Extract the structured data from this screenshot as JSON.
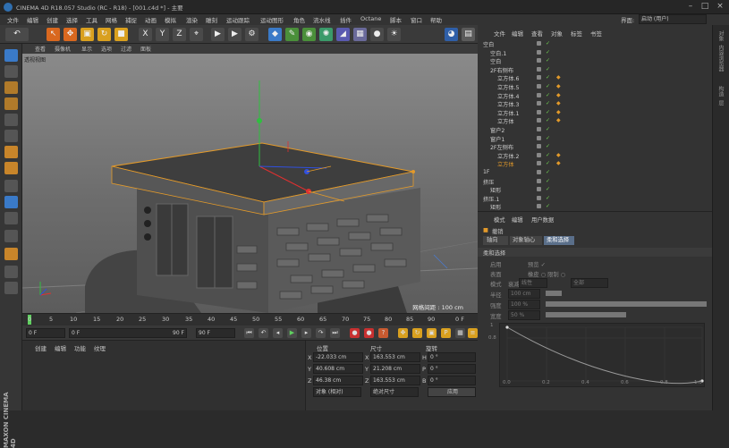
{
  "window": {
    "title": "CINEMA 4D R18.057 Studio (RC - R18) - [001.c4d *] - 主要"
  },
  "menu": {
    "items": [
      "文件",
      "编辑",
      "创建",
      "选择",
      "工具",
      "网格",
      "捕捉",
      "动画",
      "模拟",
      "渲染",
      "雕刻",
      "运动跟踪",
      "运动图形",
      "角色",
      "流水线",
      "插件",
      "Octane",
      "脚本",
      "窗口",
      "帮助"
    ],
    "interface_label": "界面:",
    "interface_value": "启动 (用户)"
  },
  "viewport": {
    "menu": [
      "查看",
      "摄像机",
      "显示",
      "选项",
      "过滤",
      "面板"
    ],
    "name": "透视视图",
    "grid_info": "网格间距 : 100 cm"
  },
  "timeline": {
    "ticks": [
      "0",
      "5",
      "10",
      "15",
      "20",
      "25",
      "30",
      "35",
      "40",
      "45",
      "50",
      "55",
      "60",
      "65",
      "70",
      "75",
      "80",
      "85",
      "90"
    ],
    "end_label": "0 F"
  },
  "playback": {
    "start": "0 F",
    "range_start": "0 F",
    "range_end": "90 F",
    "end": "90 F"
  },
  "material": {
    "menu": [
      "创建",
      "编辑",
      "功能",
      "纹理"
    ]
  },
  "coords": {
    "headers": {
      "position": "位置",
      "size": "尺寸",
      "rotation": "旋转"
    },
    "rows": [
      {
        "axis": "X",
        "pos": "-22.033 cm",
        "size_axis": "X",
        "size": "163.553 cm",
        "rot_axis": "H",
        "rot": "0 °"
      },
      {
        "axis": "Y",
        "pos": "40.608 cm",
        "size_axis": "Y",
        "size": "21.208 cm",
        "rot_axis": "P",
        "rot": "0 °"
      },
      {
        "axis": "Z",
        "pos": "46.38 cm",
        "size_axis": "Z",
        "size": "163.553 cm",
        "rot_axis": "B",
        "rot": "0 °"
      }
    ],
    "mode_object": "对象 (相对)",
    "mode_size": "绝对尺寸",
    "apply": "应用"
  },
  "objects": {
    "menu": [
      "文件",
      "编辑",
      "查看",
      "对象",
      "标签",
      "书签"
    ],
    "rows": [
      {
        "name": "空白",
        "indent": 0
      },
      {
        "name": "空白.1",
        "indent": 1
      },
      {
        "name": "空白",
        "indent": 1
      },
      {
        "name": "2F右侧布",
        "indent": 1
      },
      {
        "name": "立方体.6",
        "indent": 2
      },
      {
        "name": "立方体.5",
        "indent": 2
      },
      {
        "name": "立方体.4",
        "indent": 2
      },
      {
        "name": "立方体.3",
        "indent": 2
      },
      {
        "name": "立方体.1",
        "indent": 2
      },
      {
        "name": "立方体",
        "indent": 2
      },
      {
        "name": "窗户2",
        "indent": 1
      },
      {
        "name": "窗户1",
        "indent": 1
      },
      {
        "name": "2F左侧布",
        "indent": 1
      },
      {
        "name": "立方体.2",
        "indent": 2
      },
      {
        "name": "立方体",
        "indent": 2,
        "selected": true
      },
      {
        "name": "1F",
        "indent": 0
      },
      {
        "name": "挤压",
        "indent": 0
      },
      {
        "name": "矩形",
        "indent": 1
      },
      {
        "name": "挤压.1",
        "indent": 0
      },
      {
        "name": "矩形",
        "indent": 1
      }
    ]
  },
  "attributes": {
    "menu": [
      "模式",
      "编辑",
      "用户数据"
    ],
    "object_name": "撤销",
    "tabs": [
      "轴向",
      "对象轴心",
      "柔和选择"
    ],
    "section": "柔和选择",
    "fields": [
      {
        "label": "启用",
        "value": "预览 ✓"
      },
      {
        "label": "表面",
        "value": "橡皮 ○  限制 ○"
      },
      {
        "label": "模式",
        "value": "全部"
      },
      {
        "label": "衰减",
        "value": "线性"
      },
      {
        "label": "半径",
        "value": "100 cm"
      },
      {
        "label": "强度",
        "value": "100 %"
      },
      {
        "label": "宽度",
        "value": "50 %"
      }
    ],
    "graph_y": [
      "1",
      "0.8"
    ],
    "graph_x": [
      "0.0",
      "0.2",
      "0.4",
      "0.6",
      "0.8",
      "1.0"
    ]
  },
  "right_strip": [
    "对象",
    "内容浏览器",
    "构造",
    "层"
  ],
  "brand": "MAXON CINEMA 4D",
  "colors": {
    "accent": "#e39a2a",
    "selected_row": "#e39a2a",
    "bg": "#333333"
  }
}
